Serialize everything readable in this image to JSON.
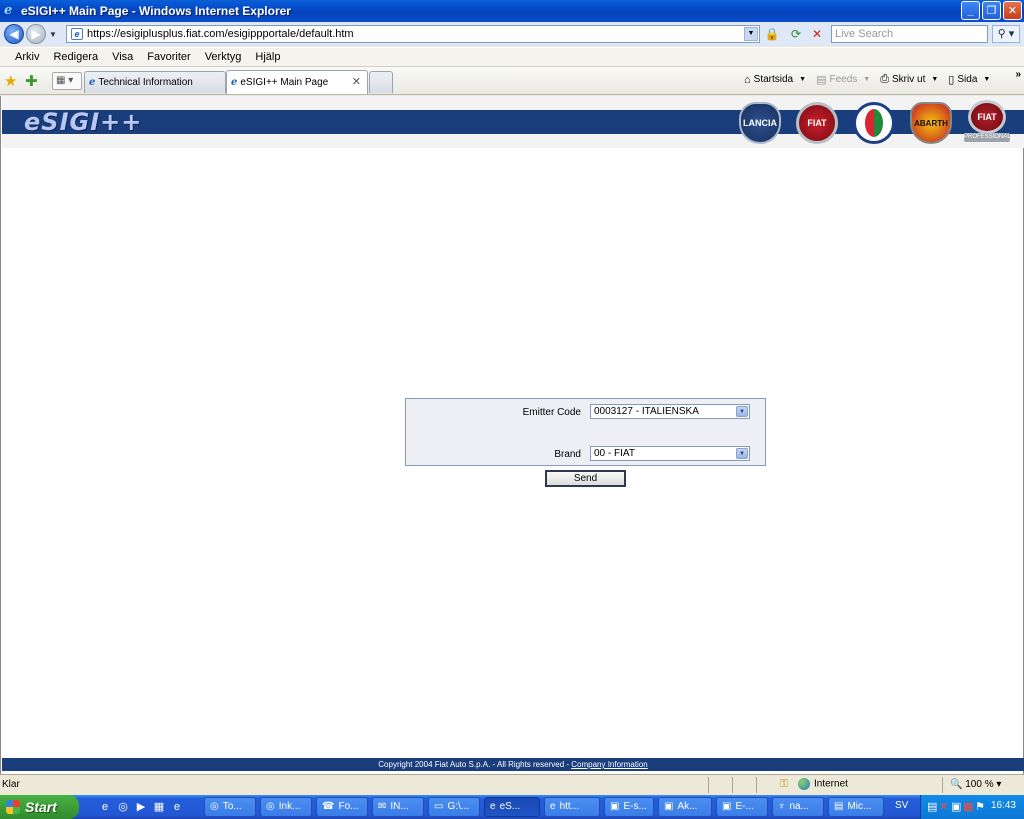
{
  "window": {
    "title": "eSIGI++ Main Page - Windows Internet Explorer",
    "btn_minimize": "_",
    "btn_restore": "❐",
    "btn_close": "✕"
  },
  "address": {
    "url": "https://esigiplusplus.fiat.com/esigippportale/default.htm",
    "search_placeholder": "Live Search"
  },
  "menu": [
    "Arkiv",
    "Redigera",
    "Visa",
    "Favoriter",
    "Verktyg",
    "Hjälp"
  ],
  "tabs": [
    {
      "label": "Technical Information"
    },
    {
      "label": "eSIGI++ Main Page"
    }
  ],
  "commandbar": {
    "home": "Startsida",
    "feeds": "Feeds",
    "print": "Skriv ut",
    "page": "Sida"
  },
  "banner": {
    "logo_text": "eSIGI++",
    "brands": [
      "LANCIA",
      "FIAT",
      "ALFA ROMEO",
      "ABARTH",
      "FIAT",
      "PROFESSIONAL"
    ]
  },
  "form": {
    "emitter_label": "Emitter Code",
    "emitter_value": "0003127 - ITALIENSKA",
    "brand_label": "Brand",
    "brand_value": "00 - FIAT",
    "send_label": "Send"
  },
  "footer": {
    "copyright": "Copyright  2004 Fiat Auto S.p.A. - All Rights reserved - ",
    "link": "Company Information"
  },
  "statusbar": {
    "status": "Klar",
    "zone": "Internet",
    "zoom": "100 %"
  },
  "taskbar": {
    "start": "Start",
    "buttons": [
      "To...",
      "Ink...",
      "Fo...",
      "IN...",
      "G:\\...",
      "eS...",
      "htt...",
      "E-s...",
      "Ak...",
      "E-...",
      "na...",
      "Mic..."
    ],
    "lang": "SV",
    "clock": "16:43"
  }
}
